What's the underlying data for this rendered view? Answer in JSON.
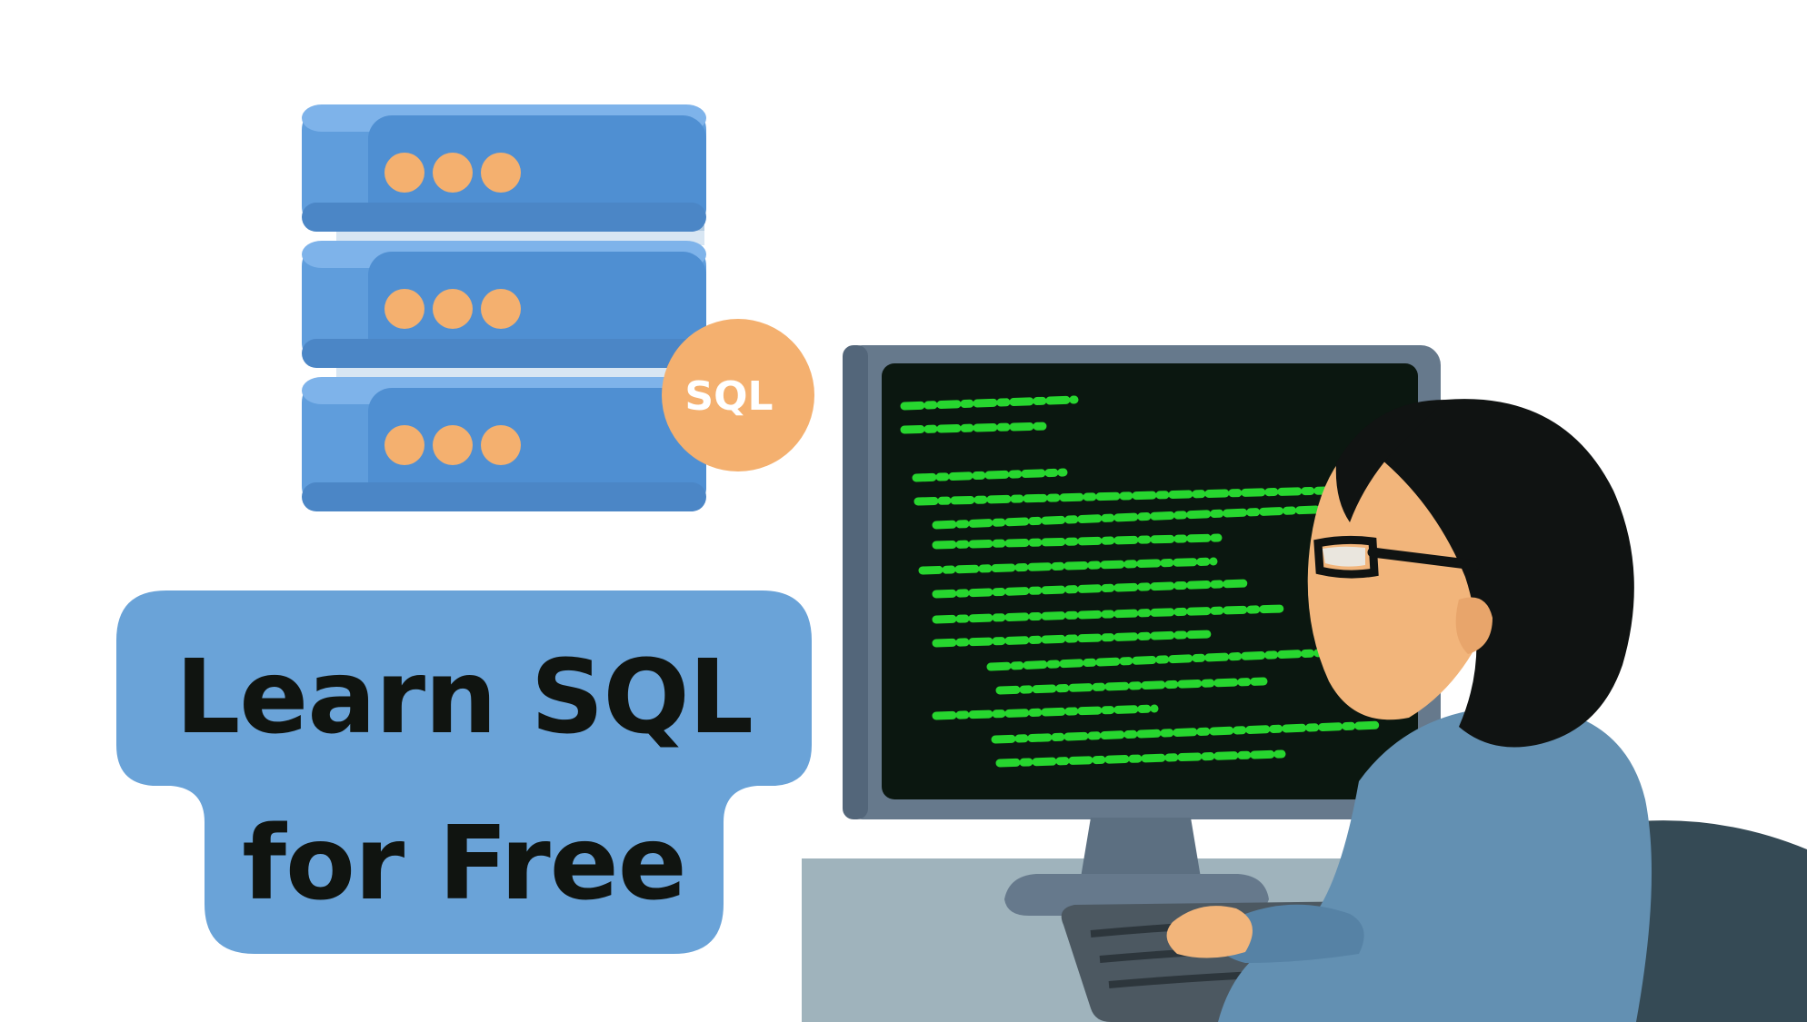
{
  "badge": {
    "text": "SQL"
  },
  "title": {
    "line1": "Learn SQL",
    "line2": "for Free"
  },
  "colors": {
    "server_blue": "#5f9ddc",
    "server_blue_dark": "#4b86c6",
    "server_blue_light": "#8ebdf0",
    "orange": "#f4b06f",
    "title_blue": "#6aa3d8",
    "title_text": "#101410",
    "screen": "#0b1710",
    "code_green": "#27d62f",
    "monitor_gray": "#66798c",
    "desk": "#9fb3bc",
    "hair": "#101312",
    "skin": "#f2b57b",
    "shirt": "#6390b2",
    "keyboard": "#4c5861",
    "chair": "#354a55"
  },
  "icons": {
    "database": "database-server-icon",
    "sql_badge": "sql-badge-icon",
    "programmer": "programmer-at-computer-illustration"
  }
}
